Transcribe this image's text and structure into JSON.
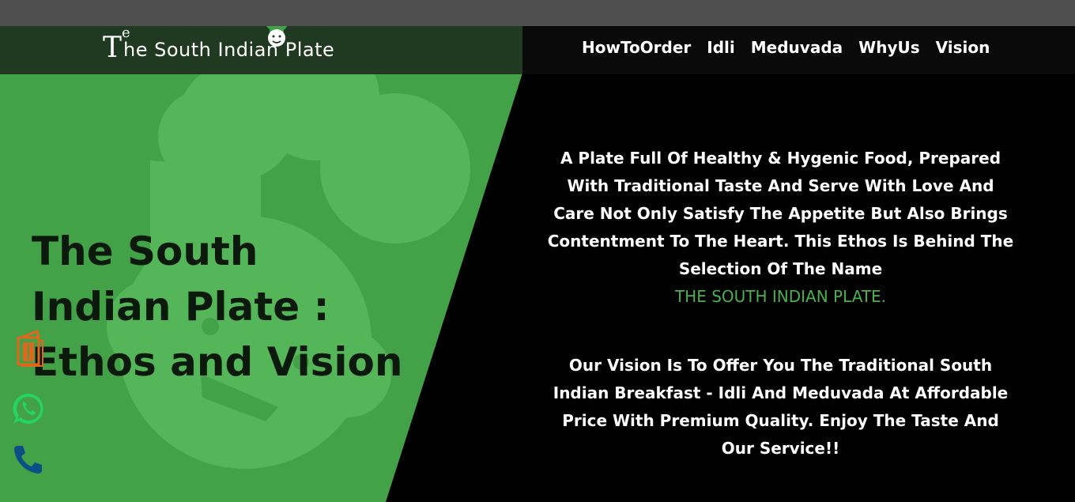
{
  "site": {
    "logo_initial": "T",
    "logo_superscript": "e",
    "logo_text": "he South Indian Plate"
  },
  "nav": {
    "items": [
      {
        "label": "HowToOrder"
      },
      {
        "label": "Idli"
      },
      {
        "label": "Meduvada"
      },
      {
        "label": "WhyUs"
      },
      {
        "label": "Vision"
      }
    ]
  },
  "hero": {
    "headline": "The South Indian Plate : Ethos and Vision"
  },
  "content": {
    "ethos_paragraph": "A Plate Full Of Healthy & Hygenic Food, Prepared With Traditional Taste And Serve With Love And Care Not Only Satisfy The Appetite But Also Brings Contentment To The Heart. This Ethos Is Behind The Selection Of The Name",
    "brand_highlight": "THE SOUTH INDIAN PLATE.",
    "vision_paragraph": "Our Vision Is To Offer You The Traditional South Indian Breakfast - Idli And Meduvada At Affordable Price With Premium Quality. Enjoy The Taste And Our Service!!"
  },
  "floating_actions": [
    {
      "icon": "menu-card-icon"
    },
    {
      "icon": "whatsapp-icon"
    },
    {
      "icon": "phone-icon"
    }
  ],
  "colors": {
    "top_bar": "#4e4f4e",
    "header_left": "#1f3a21",
    "header_right": "#0a0a0a",
    "green_panel": "#43a148",
    "mascot": "#5cbc5f",
    "brand_green": "#4caf50",
    "headline_text": "#0b1a0c",
    "body_text": "#ffffff",
    "menu_icon": "#e0661c",
    "whatsapp": "#25d366",
    "phone": "#0b4f86"
  }
}
